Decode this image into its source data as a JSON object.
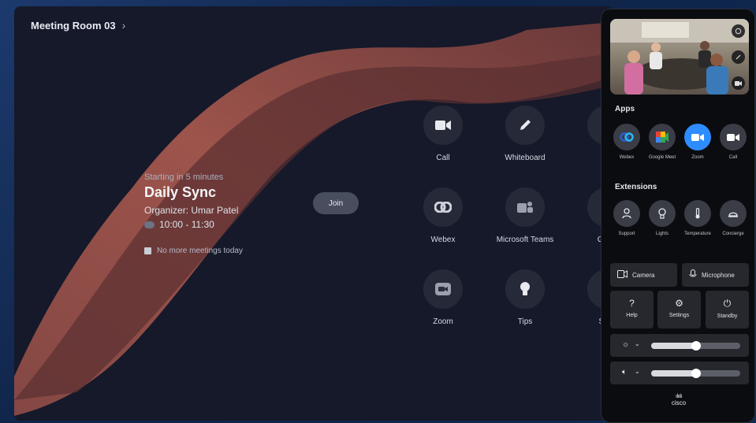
{
  "room": {
    "title": "Meeting Room 03"
  },
  "meeting": {
    "starting": "Starting in 5 minutes",
    "title": "Daily Sync",
    "organizer": "Organizer: Umar Patel",
    "time": "10:00 - 11:30",
    "no_more": "No more meetings today",
    "join_label": "Join"
  },
  "home_tiles": [
    {
      "label": "Call",
      "icon": "video-camera-icon"
    },
    {
      "label": "Whiteboard",
      "icon": "pen-icon"
    },
    {
      "label": "F",
      "icon": "partial-icon"
    },
    {
      "label": "Webex",
      "icon": "webex-icon"
    },
    {
      "label": "Microsoft Teams",
      "icon": "teams-icon"
    },
    {
      "label": "Goog",
      "icon": "partial-icon"
    },
    {
      "label": "Zoom",
      "icon": "zoom-icon"
    },
    {
      "label": "Tips",
      "icon": "lightbulb-icon"
    },
    {
      "label": "Shar",
      "icon": "partial-icon"
    }
  ],
  "panel": {
    "apps_title": "Apps",
    "apps": [
      {
        "label": "Webex",
        "icon": "webex-icon",
        "color": "#2a5fd1"
      },
      {
        "label": "Google Meet",
        "icon": "google-meet-icon",
        "color": "#34a853"
      },
      {
        "label": "Zoom",
        "icon": "zoom-icon",
        "color": "#2d8cff"
      },
      {
        "label": "Call",
        "icon": "video-camera-icon",
        "color": "#ffffff"
      }
    ],
    "extensions_title": "Extensions",
    "extensions": [
      {
        "label": "Support",
        "icon": "person-icon"
      },
      {
        "label": "Lights",
        "icon": "lightbulb-icon"
      },
      {
        "label": "Temperature",
        "icon": "thermometer-icon"
      },
      {
        "label": "Concierge",
        "icon": "bell-icon"
      }
    ],
    "camera_label": "Camera",
    "microphone_label": "Microphone",
    "help_label": "Help",
    "settings_label": "Settings",
    "standby_label": "Standby",
    "brightness_level": 0.5,
    "volume_level": 0.5,
    "brand": "cisco"
  }
}
